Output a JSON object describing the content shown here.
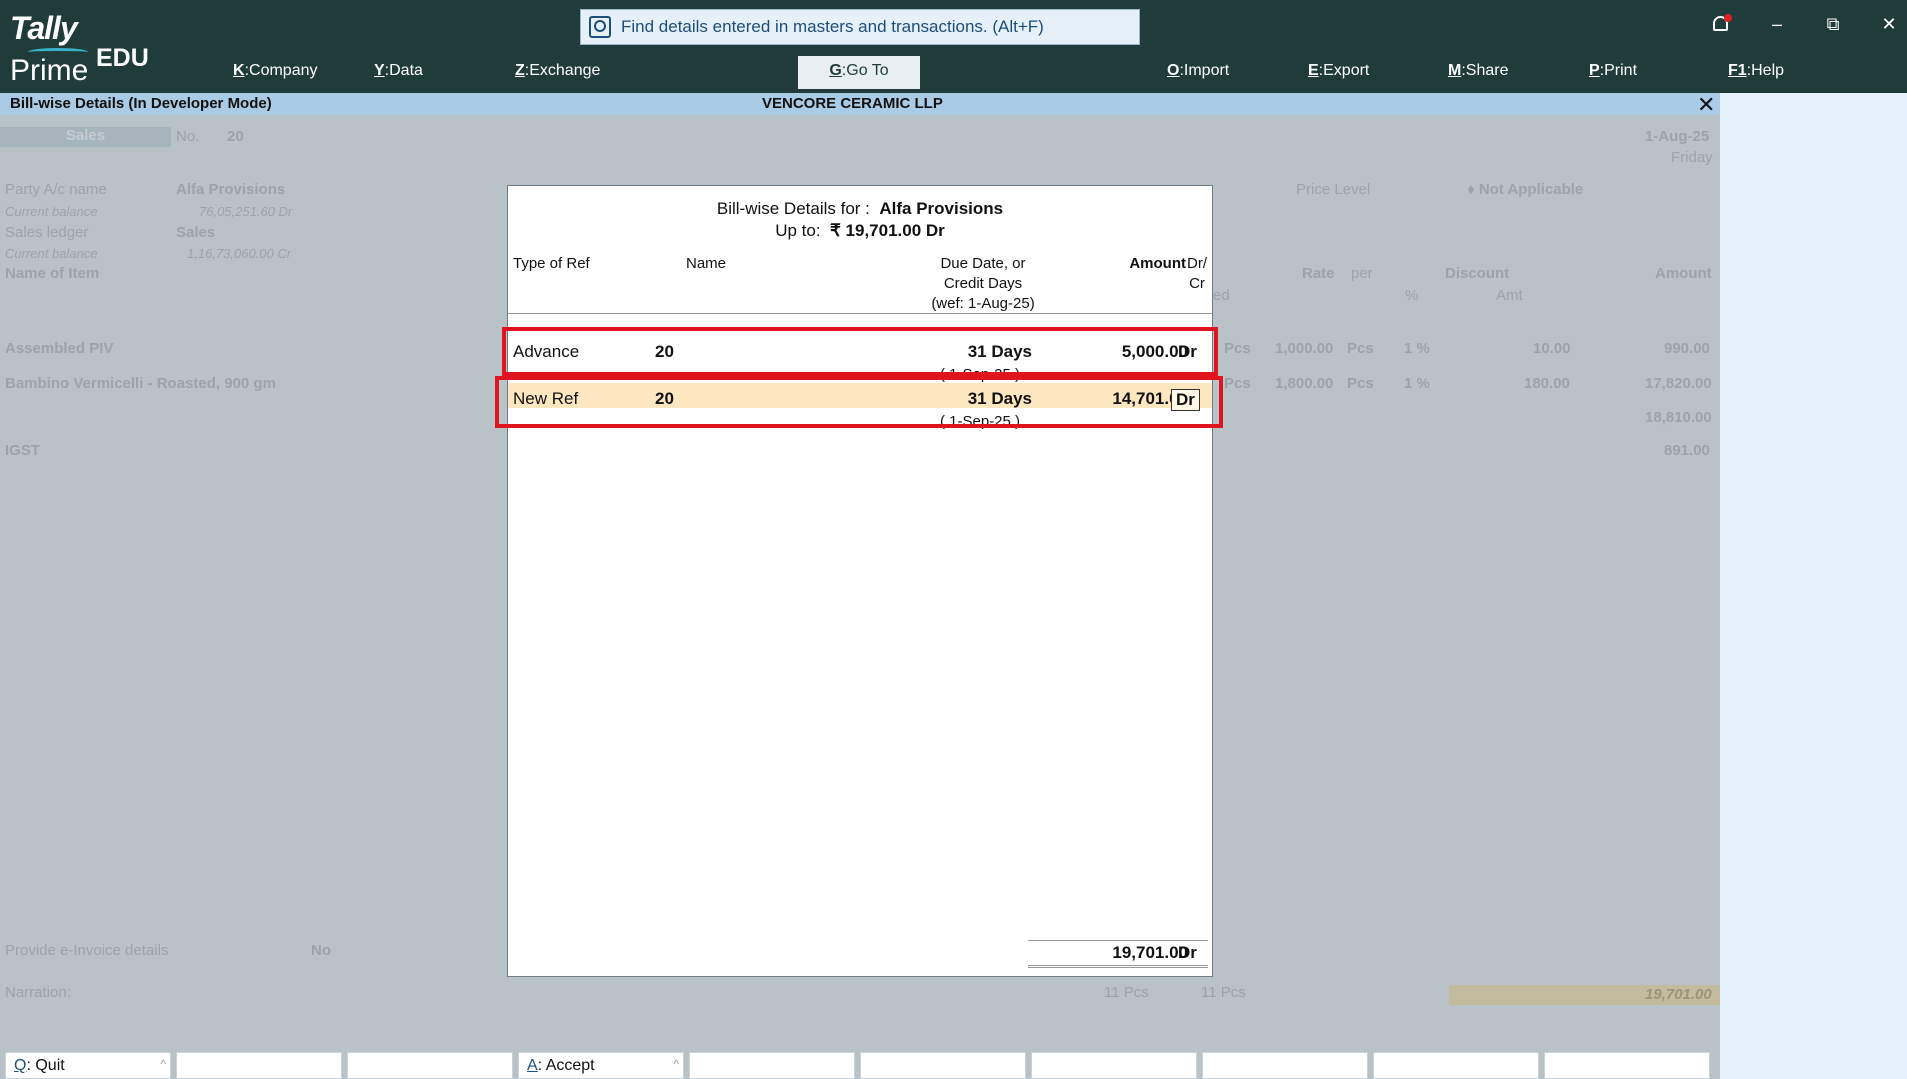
{
  "app": {
    "brand": "Tally",
    "product": "Prime",
    "edition": "EDU",
    "search_placeholder": "Find details entered in masters and transactions. (Alt+F)"
  },
  "menu": [
    {
      "key": "K",
      "label": "Company"
    },
    {
      "key": "Y",
      "label": "Data"
    },
    {
      "key": "Z",
      "label": "Exchange"
    },
    {
      "key": "G",
      "label": "Go To"
    },
    {
      "key": "O",
      "label": "Import"
    },
    {
      "key": "E",
      "label": "Export"
    },
    {
      "key": "M",
      "label": "Share"
    },
    {
      "key": "P",
      "label": "Print"
    },
    {
      "key": "F1",
      "label": "Help"
    }
  ],
  "window_controls": {
    "minimize": "–",
    "restore": "⧉",
    "close": "✕"
  },
  "subbar": {
    "title": "Bill-wise Details (In Developer Mode)",
    "company": "VENCORE CERAMIC LLP",
    "close": "✕"
  },
  "voucher": {
    "type": "Sales",
    "no_label": "No.",
    "no": "20",
    "date": "1-Aug-25",
    "day": "Friday",
    "party_label": "Party A/c name",
    "party": "Alfa Provisions",
    "party_balance_label": "Current balance",
    "party_balance": "76,05,251.60 Dr",
    "ledger_label": "Sales ledger",
    "ledger": "Sales",
    "ledger_balance_label": "Current balance",
    "ledger_balance": "1,16,73,060.00 Cr",
    "price_level_label": "Price Level",
    "price_level": "♦ Not Applicable",
    "col_item": "Name of Item",
    "col_ed": "ed",
    "col_rate": "Rate",
    "col_per": "per",
    "col_discount": "Discount",
    "col_pct": "%",
    "col_amt": "Amt",
    "col_amount": "Amount",
    "items": [
      {
        "name": "Assembled PIV",
        "unit": "Pcs",
        "rate": "1,000.00",
        "per": "Pcs",
        "pct": "1 %",
        "disc": "10.00",
        "amount": "990.00"
      },
      {
        "name": "Bambino Vermicelli - Roasted, 900 gm",
        "unit": "Pcs",
        "rate": "1,800.00",
        "per": "Pcs",
        "pct": "1 %",
        "disc": "180.00",
        "amount": "17,820.00"
      }
    ],
    "subtotal": "18,810.00",
    "tax_label": "IGST",
    "tax": "891.00",
    "einvoice_label": "Provide e-Invoice details",
    "einvoice": "No",
    "narration_label": "Narration:",
    "qty1": "11 Pcs",
    "qty2": "11 Pcs",
    "grand_total": "19,701.00"
  },
  "dialog": {
    "title_prefix": "Bill-wise Details for :",
    "party": "Alfa Provisions",
    "upto_prefix": "Up to:",
    "upto_value": "₹ 19,701.00 Dr",
    "headers": {
      "type": "Type of Ref",
      "name": "Name",
      "due_l1": "Due Date, or",
      "due_l2": "Credit Days",
      "due_l3": "(wef: 1-Aug-25)",
      "amount": "Amount",
      "drcr_l1": "Dr/",
      "drcr_l2": "Cr"
    },
    "rows": [
      {
        "type": "Advance",
        "name": "20",
        "due": "31 Days",
        "date": "( 1-Sep-25 )",
        "amount": "5,000.00",
        "drcr": "Dr"
      },
      {
        "type": "New Ref",
        "name": "20",
        "due": "31 Days",
        "date": "( 1-Sep-25 )",
        "amount": "14,701.00",
        "drcr": "Dr"
      }
    ],
    "total_amount": "19,701.00",
    "total_drcr": "Dr"
  },
  "buttons": [
    {
      "key": "Q",
      "label": "Quit"
    },
    {
      "key": "A",
      "label": "Accept"
    }
  ]
}
